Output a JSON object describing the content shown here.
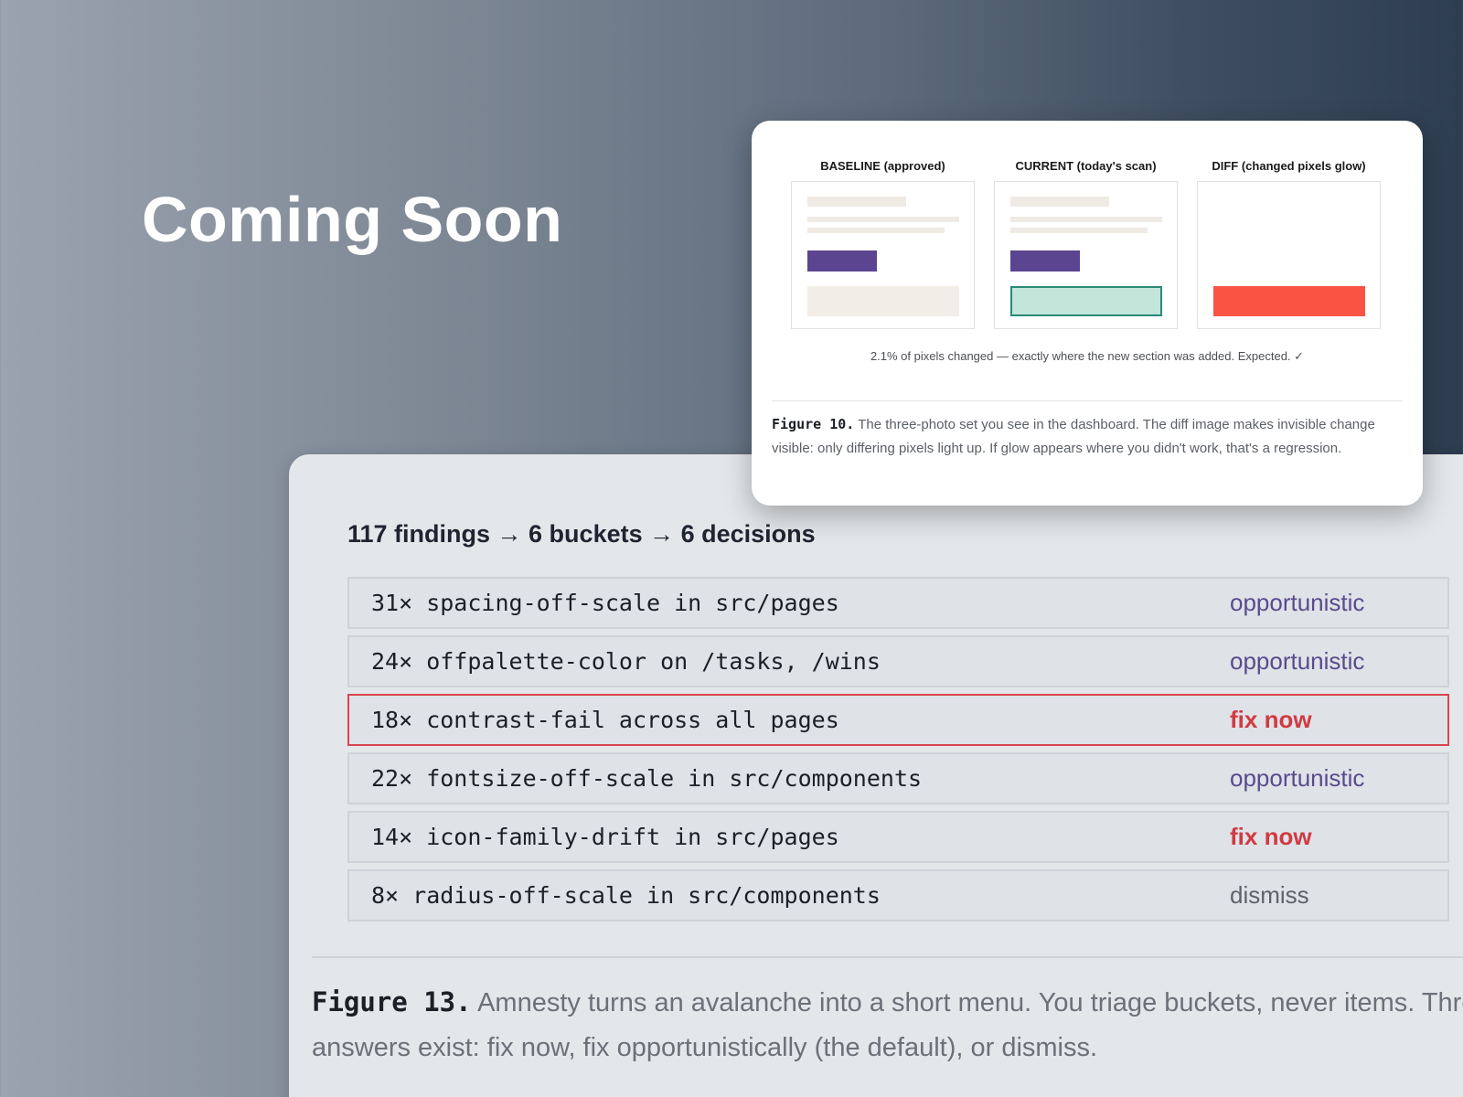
{
  "headline": "Coming Soon",
  "figure10": {
    "panels": [
      {
        "title": "BASELINE (approved)"
      },
      {
        "title": "CURRENT (today's scan)"
      },
      {
        "title": "DIFF (changed pixels glow)"
      }
    ],
    "stat": "2.1% of pixels changed — exactly where the new section was added. Expected. ✓",
    "caption_label": "Figure 10.",
    "caption_text": " The three-photo set you see in the dashboard. The diff image makes invisible change visible: only differing pixels light up. If glow appears where you didn't work, that's a regression.",
    "colors": {
      "button": "#5b4590",
      "new_section": "#c3e5da",
      "new_section_border": "#2a8a78",
      "glow": "#fa5343"
    }
  },
  "figure13": {
    "title": "117 findings → 6 buckets → 6 decisions",
    "buckets": [
      {
        "text": "31× spacing-off-scale in src/pages",
        "decision": "opportunistic"
      },
      {
        "text": "24× offpalette-color on /tasks, /wins",
        "decision": "opportunistic"
      },
      {
        "text": "18× contrast-fail across all pages",
        "decision": "fix now"
      },
      {
        "text": "22× fontsize-off-scale in src/components",
        "decision": "opportunistic"
      },
      {
        "text": "14× icon-family-drift in src/pages",
        "decision": "fix now"
      },
      {
        "text": "8× radius-off-scale in src/components",
        "decision": "dismiss"
      }
    ],
    "caption_label": "Figure 13.",
    "caption_text": " Amnesty turns an avalanche into a short menu. You triage buckets, never items. Three answers exist: fix now, fix opportunistically (the default), or dismiss.",
    "colors": {
      "opportunistic": "#5a4a8e",
      "fix_now": "#d03a42",
      "dismiss": "#5e636b",
      "highlight_border": "#d7454f"
    }
  }
}
